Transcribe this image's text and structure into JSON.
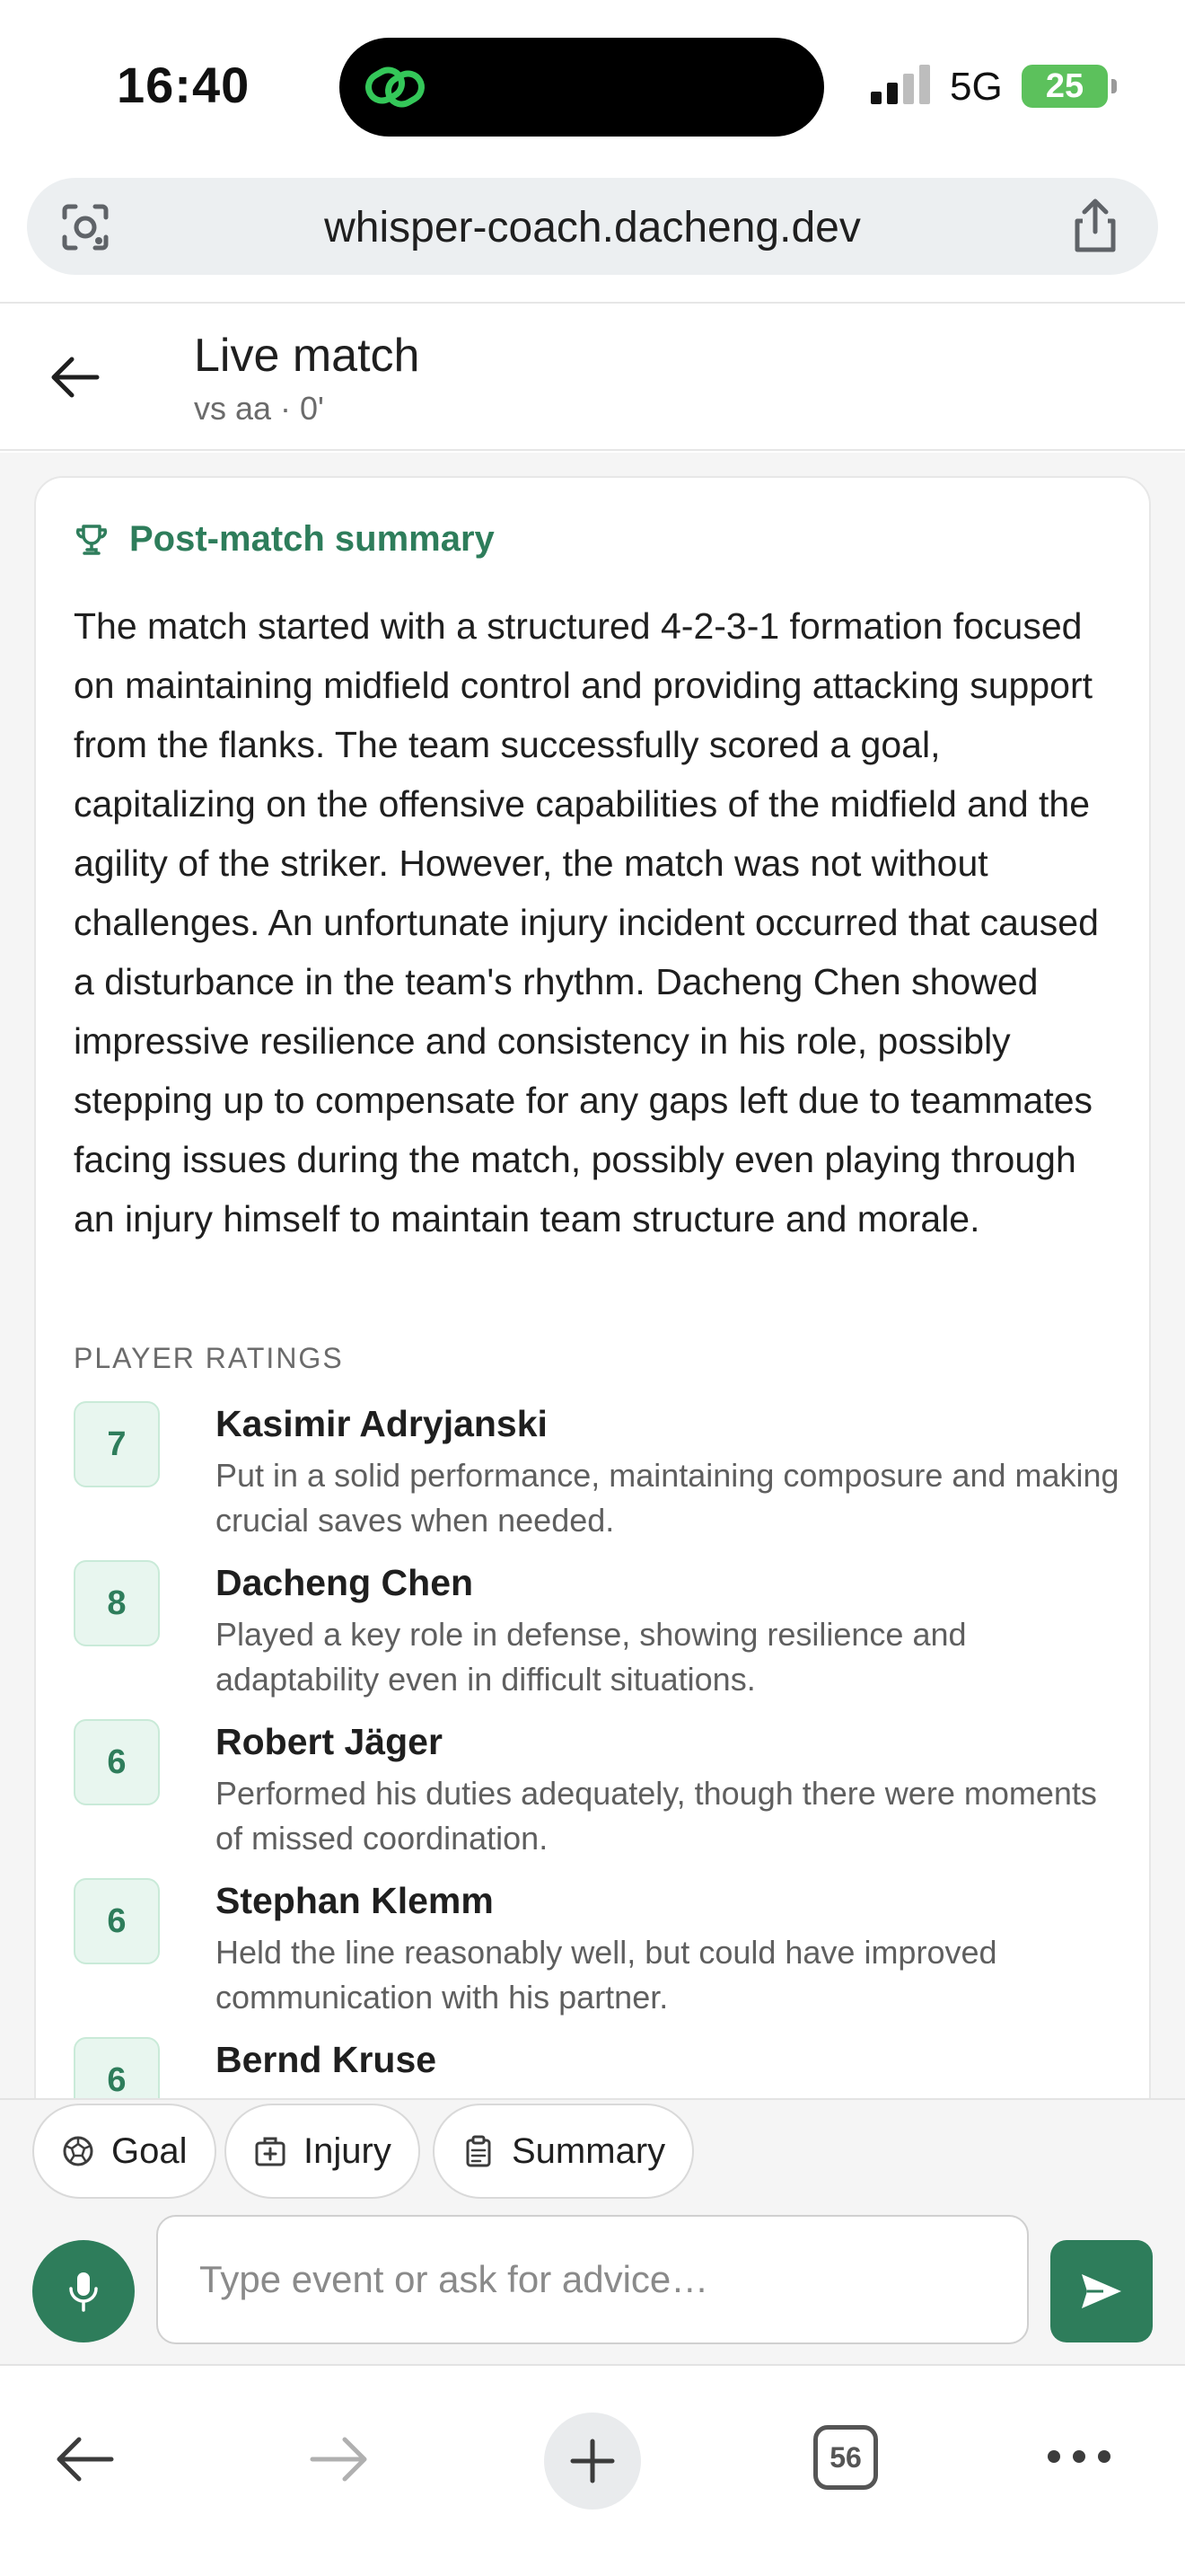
{
  "status_bar": {
    "time": "16:40",
    "network": "5G",
    "battery": "25"
  },
  "browser": {
    "url": "whisper-coach.dacheng.dev",
    "tab_count": "56"
  },
  "header": {
    "title": "Live match",
    "subtitle": "vs aa · 0'"
  },
  "summary": {
    "title": "Post-match summary",
    "body": "The match started with a structured 4-2-3-1 formation focused on maintaining midfield control and providing attacking support from the flanks. The team successfully scored a goal, capitalizing on the offensive capabilities of the midfield and the agility of the striker. However, the match was not without challenges. An unfortunate injury incident occurred that caused a disturbance in the team's rhythm. Dacheng Chen showed impressive resilience and consistency in his role, possibly stepping up to compensate for any gaps left due to teammates facing issues during the match, possibly even playing through an injury himself to maintain team structure and morale."
  },
  "ratings": {
    "label": "PLAYER RATINGS",
    "players": [
      {
        "rating": "7",
        "name": "Kasimir Adryjanski",
        "note": "Put in a solid performance, maintaining composure and making crucial saves when needed."
      },
      {
        "rating": "8",
        "name": "Dacheng Chen",
        "note": "Played a key role in defense, showing resilience and adaptability even in difficult situations."
      },
      {
        "rating": "6",
        "name": "Robert Jäger",
        "note": "Performed his duties adequately, though there were moments of missed coordination."
      },
      {
        "rating": "6",
        "name": "Stephan Klemm",
        "note": "Held the line reasonably well, but could have improved communication with his partner."
      },
      {
        "rating": "6",
        "name": "Bernd Kruse",
        "note": ""
      }
    ]
  },
  "chips": {
    "goal": "Goal",
    "injury": "Injury",
    "summary": "Summary"
  },
  "composer": {
    "placeholder": "Type event or ask for advice…"
  },
  "colors": {
    "accent": "#2e7d5b",
    "badge_bg": "#e8f6ef"
  }
}
